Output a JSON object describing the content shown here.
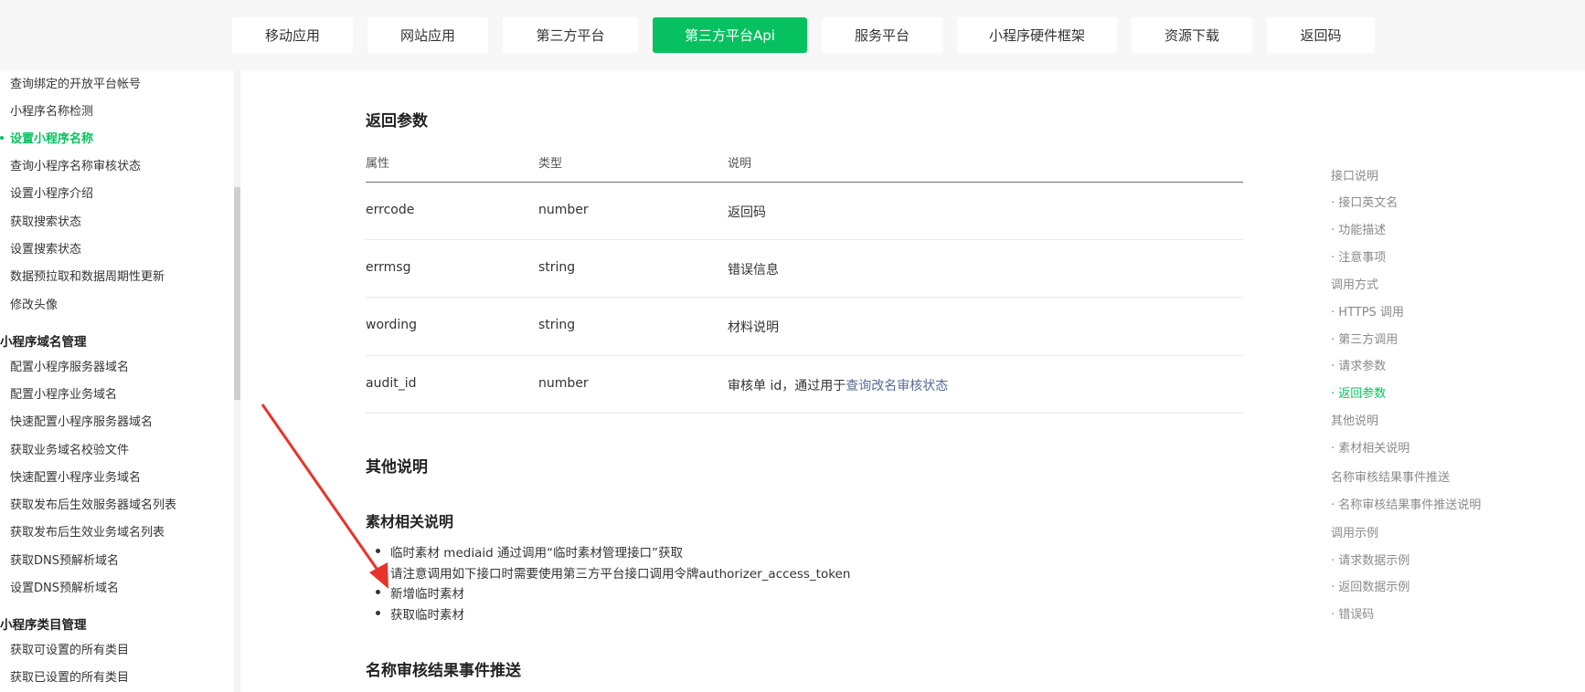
{
  "tabs": [
    {
      "label": "移动应用",
      "active": false
    },
    {
      "label": "网站应用",
      "active": false
    },
    {
      "label": "第三方平台",
      "active": false
    },
    {
      "label": "第三方平台Api",
      "active": true
    },
    {
      "label": "服务平台",
      "active": false
    },
    {
      "label": "小程序硬件框架",
      "active": false
    },
    {
      "label": "资源下载",
      "active": false
    },
    {
      "label": "返回码",
      "active": false
    }
  ],
  "sidebar": {
    "items": [
      "查询绑定的开放平台帐号",
      "小程序名称检测",
      "设置小程序名称",
      "查询小程序名称审核状态",
      "设置小程序介绍",
      "获取搜索状态",
      "设置搜索状态",
      "数据预拉取和数据周期性更新",
      "修改头像"
    ],
    "active_index": 2,
    "group_domain": "小程序域名管理",
    "domain_items": [
      "配置小程序服务器域名",
      "配置小程序业务域名",
      "快速配置小程序服务器域名",
      "获取业务域名校验文件",
      "快速配置小程序业务域名",
      "获取发布后生效服务器域名列表",
      "获取发布后生效业务域名列表",
      "获取DNS预解析域名",
      "设置DNS预解析域名"
    ],
    "group_category": "小程序类目管理",
    "category_items": [
      "获取可设置的所有类目",
      "获取已设置的所有类目"
    ]
  },
  "main": {
    "return_params_title": "返回参数",
    "table_headers": [
      "属性",
      "类型",
      "说明"
    ],
    "rows": [
      {
        "name": "errcode",
        "type": "number",
        "desc": "返回码",
        "link": ""
      },
      {
        "name": "errmsg",
        "type": "string",
        "desc": "错误信息",
        "link": ""
      },
      {
        "name": "wording",
        "type": "string",
        "desc": "材料说明",
        "link": ""
      },
      {
        "name": "audit_id",
        "type": "number",
        "desc": "审核单 id，通过用于",
        "link": "查询改名审核状态"
      }
    ],
    "other_title": "其他说明",
    "material_title": "素材相关说明",
    "list": [
      {
        "text": "临时素材 mediaid 通过调用“临时素材管理接口”获取",
        "is_link": false
      },
      {
        "text": "请注意调用如下接口时需要使用第三方平台接口调用令牌authorizer_access_token",
        "is_link": false
      },
      {
        "text": "新增临时素材",
        "is_link": true
      },
      {
        "text": "获取临时素材",
        "is_link": true
      }
    ],
    "event_title": "名称审核结果事件推送"
  },
  "toc": [
    {
      "label": "接口说明",
      "level": 1
    },
    {
      "label": "· 接口英文名",
      "level": 2
    },
    {
      "label": "· 功能描述",
      "level": 2
    },
    {
      "label": "· 注意事项",
      "level": 2
    },
    {
      "label": "调用方式",
      "level": 1
    },
    {
      "label": "· HTTPS 调用",
      "level": 2
    },
    {
      "label": "· 第三方调用",
      "level": 2
    },
    {
      "label": "· 请求参数",
      "level": 2
    },
    {
      "label": "· 返回参数",
      "level": 2,
      "active": true
    },
    {
      "label": "其他说明",
      "level": 1
    },
    {
      "label": "· 素材相关说明",
      "level": 2
    },
    {
      "label": "名称审核结果事件推送",
      "level": 1
    },
    {
      "label": "· 名称审核结果事件推送说明",
      "level": 2
    },
    {
      "label": "调用示例",
      "level": 1
    },
    {
      "label": "· 请求数据示例",
      "level": 2
    },
    {
      "label": "· 返回数据示例",
      "level": 2
    },
    {
      "label": "· 错误码",
      "level": 2
    }
  ],
  "colors": {
    "accent": "#07c160",
    "link": "#576b95",
    "annotation_arrow": "#e8332a"
  }
}
